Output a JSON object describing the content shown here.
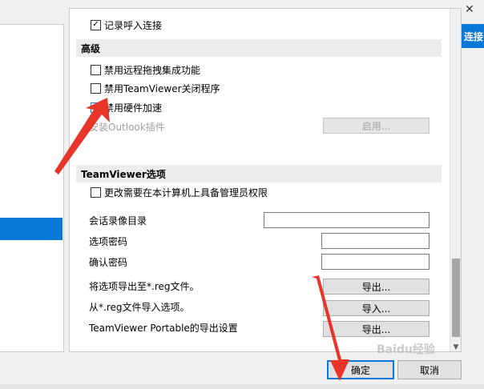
{
  "advanced": {
    "header": "高级",
    "partial_row": "记录呼入连接",
    "options": [
      {
        "label": "禁用远程拖拽集成功能",
        "checked": false
      },
      {
        "label": "禁用TeamViewer关闭程序",
        "checked": false
      },
      {
        "label": "禁用硬件加速",
        "checked": false
      }
    ],
    "outlook_label": "安装Outlook插件",
    "enable_button": "启用..."
  },
  "tv_options": {
    "header": "TeamViewer选项",
    "admin_option": {
      "label": "更改需要在本计算机上具备管理员权限",
      "checked": false
    },
    "recording_dir_label": "会话录像目录",
    "recording_dir_value": "",
    "option_password_label": "选项密码",
    "option_password_value": "",
    "confirm_password_label": "确认密码",
    "confirm_password_value": "",
    "export_reg_label": "将选项导出至*.reg文件。",
    "export_button": "导出...",
    "import_reg_label": "从*.reg文件导入选项。",
    "import_button": "导入...",
    "portable_label": "TeamViewer Portable的导出设置",
    "portable_export_button": "导出..."
  },
  "dialog": {
    "ok_label": "确定",
    "cancel_label": "取消"
  },
  "background_window": {
    "close_glyph": "✕",
    "blue_text": "连接"
  },
  "watermark": "Baidu经验",
  "colors": {
    "accent": "#0a78d7",
    "annotation_arrow": "#e8352a"
  }
}
